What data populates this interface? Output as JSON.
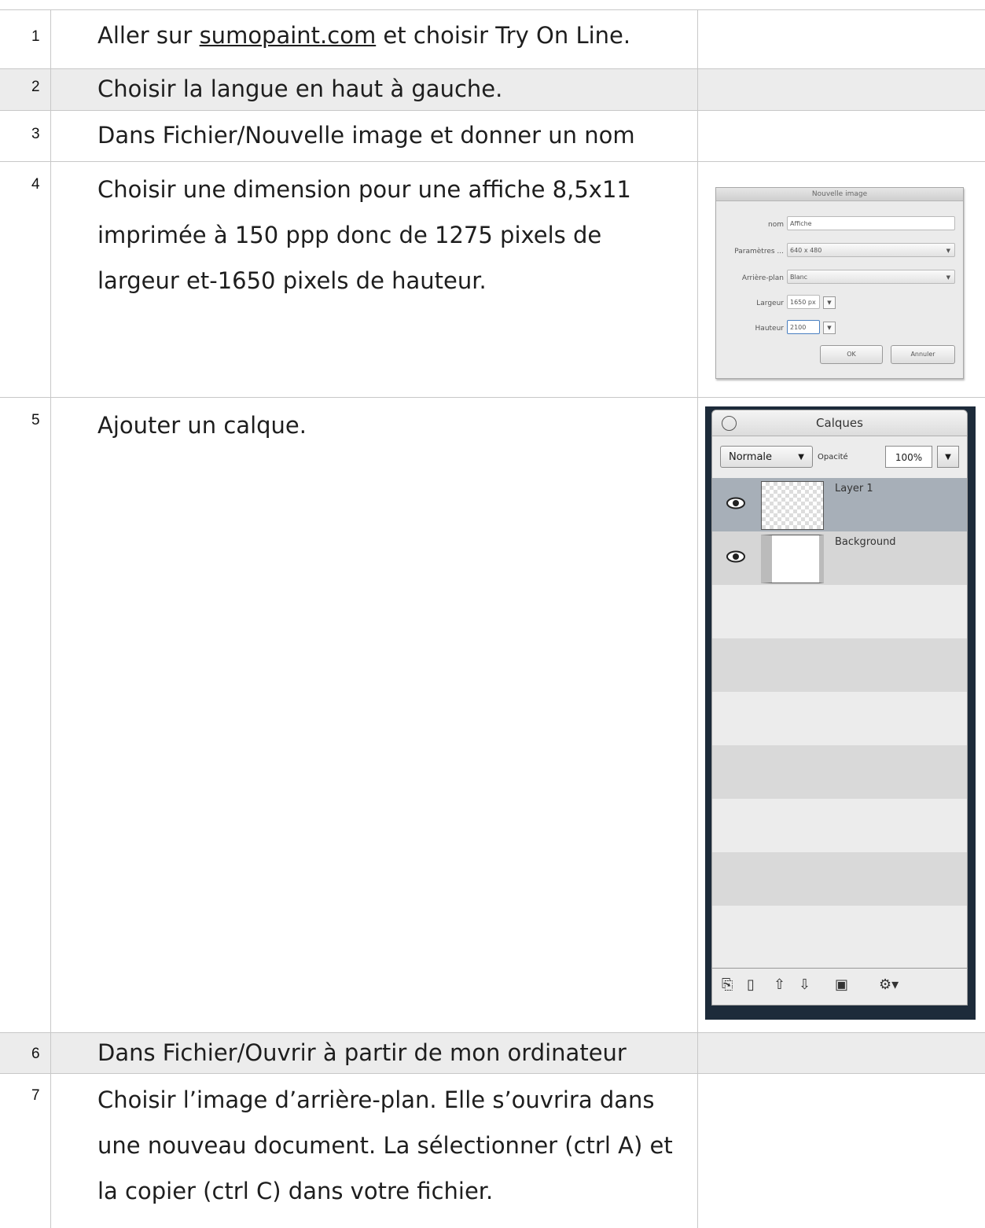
{
  "rows": [
    {
      "num": "1",
      "text_pre": "Aller sur ",
      "link": "sumopaint.com",
      "text_post": " et choisir Try On Line."
    },
    {
      "num": "2",
      "text": "Choisir la langue en haut à gauche."
    },
    {
      "num": "3",
      "text": "Dans Fichier/Nouvelle image et donner un nom"
    },
    {
      "num": "4",
      "lines": [
        "Choisir une dimension pour une affiche 8,5x11",
        "imprimée à 150 ppp donc de 1275 pixels de",
        "largeur et-1650 pixels de hauteur."
      ]
    },
    {
      "num": "5",
      "text": "Ajouter un calque."
    },
    {
      "num": "6",
      "text": "Dans Fichier/Ouvrir à partir de mon ordinateur"
    },
    {
      "num": "7",
      "lines": [
        "Choisir l’image d’arrière-plan. Elle s’ouvrira dans",
        "une nouveau document. La sélectionner (ctrl A) et",
        "la copier (ctrl C) dans votre fichier."
      ]
    }
  ],
  "dialog": {
    "title": "Nouvelle image",
    "nom_label": "nom",
    "nom_value": "Affiche",
    "preset_label": "Paramètres ...",
    "preset_value": "640 x 480",
    "bg_label": "Arrière-plan",
    "bg_value": "Blanc",
    "width_label": "Largeur",
    "width_value": "1650 px",
    "height_label": "Hauteur",
    "height_value": "2100",
    "ok": "OK",
    "cancel": "Annuler"
  },
  "layers_panel": {
    "title": "Calques",
    "blend_mode": "Normale",
    "opacity_label": "Opacité",
    "opacity_value": "100%",
    "layers": [
      {
        "name": "Layer 1"
      },
      {
        "name": "Background"
      }
    ]
  },
  "colors": {
    "shaded_row": "#ececec",
    "grid_line": "#c8c8c8",
    "selected_layer": "#a7afb8"
  }
}
